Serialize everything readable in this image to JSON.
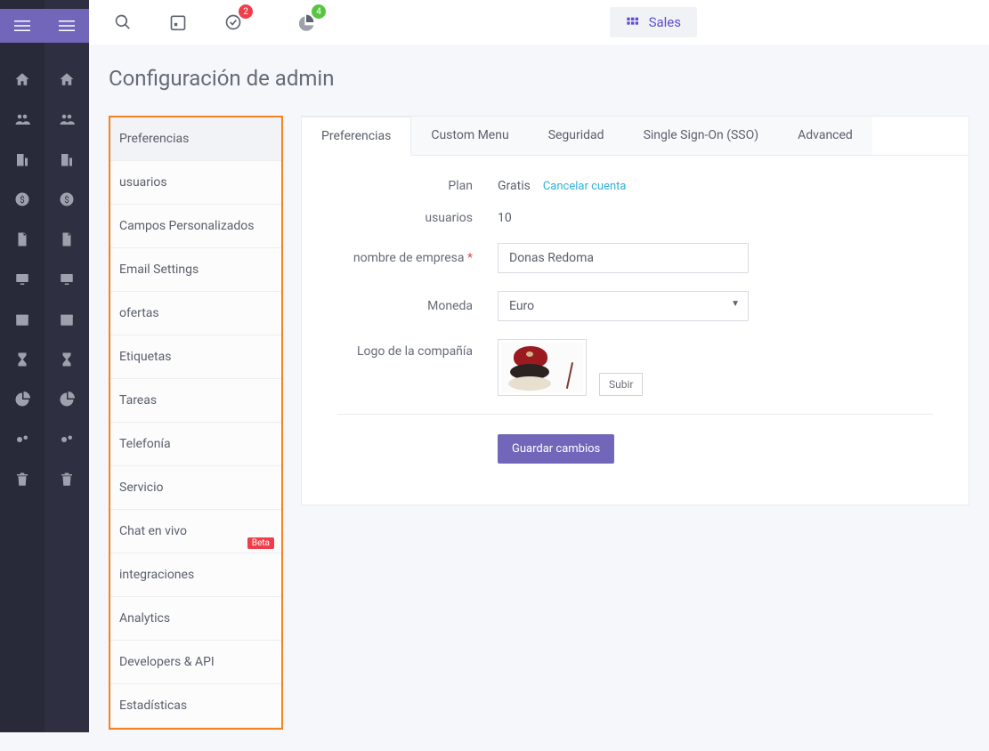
{
  "topbar": {
    "task_badge": "2",
    "chart_badge": "4",
    "sales_label": "Sales"
  },
  "page": {
    "title": "Configuración de admin"
  },
  "settings_nav": [
    "Preferencias",
    "usuarios",
    "Campos Personalizados",
    "Email Settings",
    "ofertas",
    "Etiquetas",
    "Tareas",
    "Telefonía",
    "Servicio",
    "Chat en vivo",
    "integraciones",
    "Analytics",
    "Developers & API",
    "Estadísticas"
  ],
  "settings_nav_active_index": 0,
  "settings_nav_beta_index": 9,
  "beta_label": "Beta",
  "tabs": [
    "Preferencias",
    "Custom Menu",
    "Seguridad",
    "Single Sign-On (SSO)",
    "Advanced"
  ],
  "tabs_active_index": 0,
  "form": {
    "plan_label": "Plan",
    "plan_value": "Gratis",
    "cancel_link": "Cancelar cuenta",
    "users_label": "usuarios",
    "users_value": "10",
    "company_label": "nombre de empresa",
    "company_value": "Donas Redoma",
    "currency_label": "Moneda",
    "currency_value": "Euro",
    "logo_label": "Logo de la compañía",
    "upload_btn": "Subir",
    "save_btn": "Guardar cambios"
  }
}
